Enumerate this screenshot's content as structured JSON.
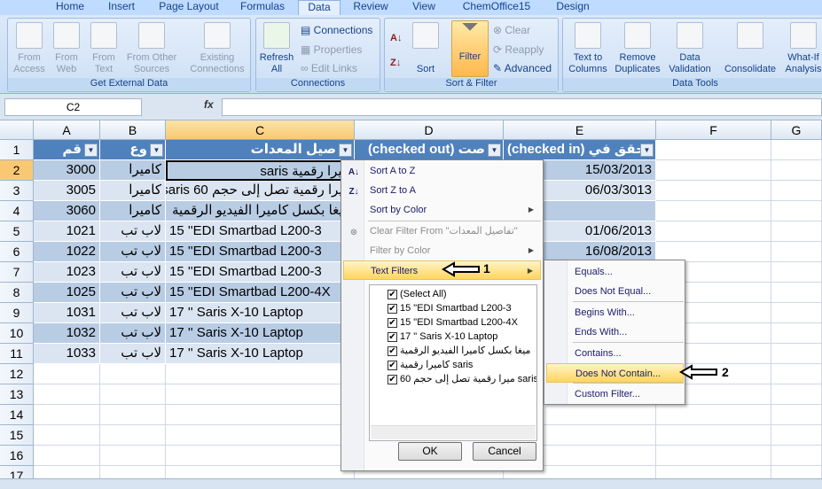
{
  "tabs": [
    "Home",
    "Insert",
    "Page Layout",
    "Formulas",
    "Data",
    "Review",
    "View",
    "ChemOffice15",
    "Design"
  ],
  "active_tab": "Data",
  "ribbon": {
    "get_external": {
      "label": "Get External Data",
      "from_access": "From Access",
      "from_web": "From Web",
      "from_text": "From Text",
      "from_other": "From Other Sources",
      "existing": "Existing Connections"
    },
    "connections": {
      "label": "Connections",
      "refresh_all": "Refresh All",
      "connections": "Connections",
      "properties": "Properties",
      "edit_links": "Edit Links"
    },
    "sort_filter": {
      "label": "Sort & Filter",
      "sort": "Sort",
      "filter": "Filter",
      "clear": "Clear",
      "reapply": "Reapply",
      "advanced": "Advanced"
    },
    "data_tools": {
      "label": "Data Tools",
      "text_to_columns": "Text to Columns",
      "remove_duplicates": "Remove Duplicates",
      "data_validation": "Data Validation",
      "consolidate": "Consolidate",
      "what_if": "What-If Analysis"
    }
  },
  "formula_bar": {
    "name_box": "C2",
    "fx": "fx",
    "value": ""
  },
  "columns": [
    "A",
    "B",
    "C",
    "D",
    "E",
    "F",
    "G"
  ],
  "selected_column": "C",
  "headers": [
    "قم",
    "وع",
    "صيل المعدات",
    "(checked out) صت",
    "(checked in) حقق في"
  ],
  "rows": [
    {
      "n": "1"
    },
    {
      "n": "2",
      "a": "3000",
      "b": "كاميرا",
      "c": "ميرا رقمية saris",
      "e": "15/03/2013"
    },
    {
      "n": "3",
      "a": "3005",
      "b": "كاميرا",
      "c": "ميرا رقمية تصل إلى حجم 60 saris",
      "e": "06/03/3013"
    },
    {
      "n": "4",
      "a": "3060",
      "b": "كاميرا",
      "c": "ميغا بكسل كاميرا الفيديو الرقمية",
      "e": ""
    },
    {
      "n": "5",
      "a": "1021",
      "b": "لاب تب",
      "c": "15 ''EDI Smartbad L200-3",
      "e": "01/06/2013"
    },
    {
      "n": "6",
      "a": "1022",
      "b": "لاب تب",
      "c": "15 ''EDI Smartbad L200-3",
      "e": "16/08/2013"
    },
    {
      "n": "7",
      "a": "1023",
      "b": "لاب تب",
      "c": "15 ''EDI Smartbad L200-3",
      "e": ""
    },
    {
      "n": "8",
      "a": "1025",
      "b": "لاب تب",
      "c": "15 ''EDI Smartbad L200-4X",
      "e": ""
    },
    {
      "n": "9",
      "a": "1031",
      "b": "لاب تب",
      "c": "17 '' Saris X-10 Laptop",
      "e": ""
    },
    {
      "n": "10",
      "a": "1032",
      "b": "لاب تب",
      "c": "17 '' Saris X-10 Laptop",
      "e": ""
    },
    {
      "n": "11",
      "a": "1033",
      "b": "لاب تب",
      "c": "17 '' Saris X-10 Laptop",
      "e": ""
    },
    {
      "n": "12"
    },
    {
      "n": "13"
    },
    {
      "n": "14"
    },
    {
      "n": "15"
    },
    {
      "n": "16"
    },
    {
      "n": "17"
    }
  ],
  "filter_menu": {
    "sort_az": "Sort A to Z",
    "sort_za": "Sort Z to A",
    "sort_color": "Sort by Color",
    "clear_filter": "Clear Filter From \"تفاصيل المعدات\"",
    "filter_color": "Filter by Color",
    "text_filters": "Text Filters",
    "list": [
      {
        "label": "(Select All)",
        "checked": true
      },
      {
        "label": "15 \"EDI Smartbad L200-3",
        "checked": true
      },
      {
        "label": "15 \"EDI Smartbad L200-4X",
        "checked": true
      },
      {
        "label": "17 \" Saris X-10 Laptop",
        "checked": true
      },
      {
        "label": "ميغا بكسل كاميرا الفيديو الرقمية",
        "checked": true
      },
      {
        "label": "كاميرا رقمية saris",
        "checked": true
      },
      {
        "label": "ميرا رقمية تصل إلى حجم 60 saris",
        "checked": true
      }
    ],
    "ok": "OK",
    "cancel": "Cancel"
  },
  "text_filters_submenu": [
    "Equals...",
    "Does Not Equal...",
    "Begins With...",
    "Ends With...",
    "Contains...",
    "Does Not Contain...",
    "Custom Filter..."
  ],
  "highlighted_submenu_item": "Does Not Contain...",
  "callouts": {
    "one": "1",
    "two": "2"
  },
  "colors": {
    "header_fill": "#4f81bd",
    "band_dark": "#b8cce4",
    "band_light": "#dbe5f1",
    "highlight": "#ffd55d"
  }
}
